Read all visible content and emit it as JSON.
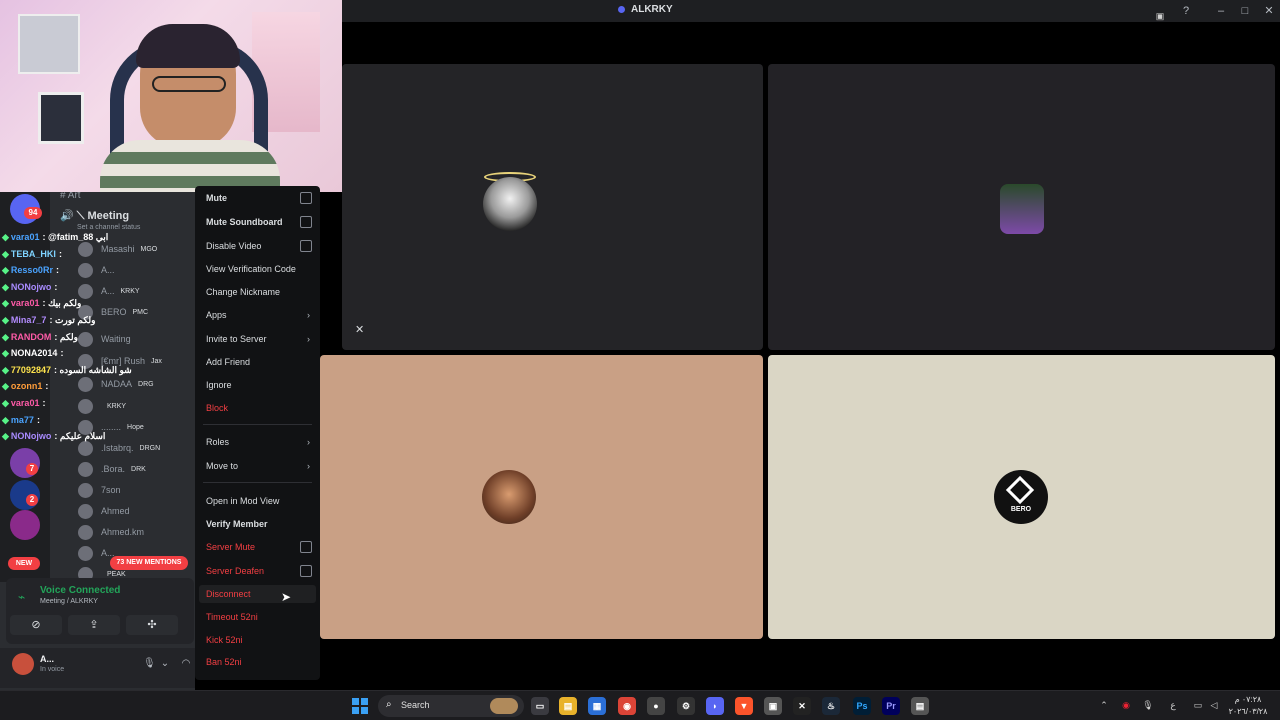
{
  "window": {
    "title": "ALKRKY"
  },
  "tiles": {
    "bottom_right_label": "BERO"
  },
  "channel": {
    "category_label": "Art",
    "name": "Meeting",
    "status_placeholder": "Set a channel status"
  },
  "members": [
    {
      "name": "Masashi",
      "tag": "MGO"
    },
    {
      "name": "A...",
      "tag": ""
    },
    {
      "name": "A...",
      "tag": "KRKY"
    },
    {
      "name": "BERO",
      "tag": "PMC"
    },
    {
      "name": "Waiting",
      "tag": ""
    },
    {
      "name": "[€mr] Rush",
      "tag": "Jax"
    },
    {
      "name": "NADAA",
      "tag": "DRG"
    },
    {
      "name": "",
      "tag": "KRKY"
    },
    {
      "name": "........",
      "tag": "Hope"
    },
    {
      "name": ".Istabrq.",
      "tag": "DRGN"
    },
    {
      "name": ".Bora.",
      "tag": "DRK"
    },
    {
      "name": "7son",
      "tag": ""
    },
    {
      "name": "Ahmed",
      "tag": ""
    },
    {
      "name": "Ahmed.km",
      "tag": ""
    },
    {
      "name": "A...",
      "tag": ""
    },
    {
      "name": "",
      "tag": "PEAK"
    }
  ],
  "chat": [
    {
      "user": "vara01",
      "color": "#4aa3ff",
      "msg": ": @fatim_88 ابي"
    },
    {
      "user": "TEBA_HKI",
      "color": "#7fd3ff",
      "msg": ":"
    },
    {
      "user": "Resso0Rr",
      "color": "#4aa3ff",
      "msg": ":"
    },
    {
      "user": "NONojwo",
      "color": "#a98bff",
      "msg": ":"
    },
    {
      "user": "vara01",
      "color": "#ff5ba8",
      "msg": ": ولكم بيك"
    },
    {
      "user": "Mina7_7",
      "color": "#b38cff",
      "msg": ": ولكم تورت"
    },
    {
      "user": "RANDOM",
      "color": "#ff5ba8",
      "msg": ": ولكم"
    },
    {
      "user": "NONA2014",
      "color": "#ffffff",
      "msg": ":"
    },
    {
      "user": "77092847",
      "color": "#ffe44d",
      "msg": ": شو الشاشه السوده"
    },
    {
      "user": "ozonn1",
      "color": "#ff9d3a",
      "msg": ":"
    },
    {
      "user": "vara01",
      "color": "#ff5ba8",
      "msg": ":"
    },
    {
      "user": "ma77",
      "color": "#4aa3ff",
      "msg": ":"
    },
    {
      "user": "NONojwo",
      "color": "#a98bff",
      "msg": ": اسلام عليكم"
    }
  ],
  "badges": {
    "server_1": "94",
    "server_2": "7",
    "server_3": "2"
  },
  "pills": {
    "new": "NEW",
    "mentions": "73 NEW MENTIONS"
  },
  "voice": {
    "title": "Voice Connected",
    "subtitle": "Meeting / ALKRKY"
  },
  "user": {
    "name": "A...",
    "status": "In voice"
  },
  "context_menu": {
    "mute": "Mute",
    "mute_soundboard": "Mute Soundboard",
    "disable_video": "Disable Video",
    "view_verification_code": "View Verification Code",
    "change_nickname": "Change Nickname",
    "apps": "Apps",
    "invite_to_server": "Invite to Server",
    "add_friend": "Add Friend",
    "ignore": "Ignore",
    "block": "Block",
    "roles": "Roles",
    "move_to": "Move to",
    "open_in_mod_view": "Open in Mod View",
    "verify_member": "Verify Member",
    "server_mute": "Server Mute",
    "server_deafen": "Server Deafen",
    "disconnect": "Disconnect",
    "timeout": "Timeout 52ni",
    "kick": "Kick 52ni",
    "ban": "Ban 52ni"
  },
  "taskbar": {
    "search_label": "Search",
    "clock_time": "٠٧:٢٨ م",
    "clock_date": "٢٠٢٦/٠٣/٢٨",
    "lang": "ع"
  },
  "colors": {
    "accent": "#5865f2",
    "danger": "#f23f43",
    "online": "#23a55a"
  }
}
